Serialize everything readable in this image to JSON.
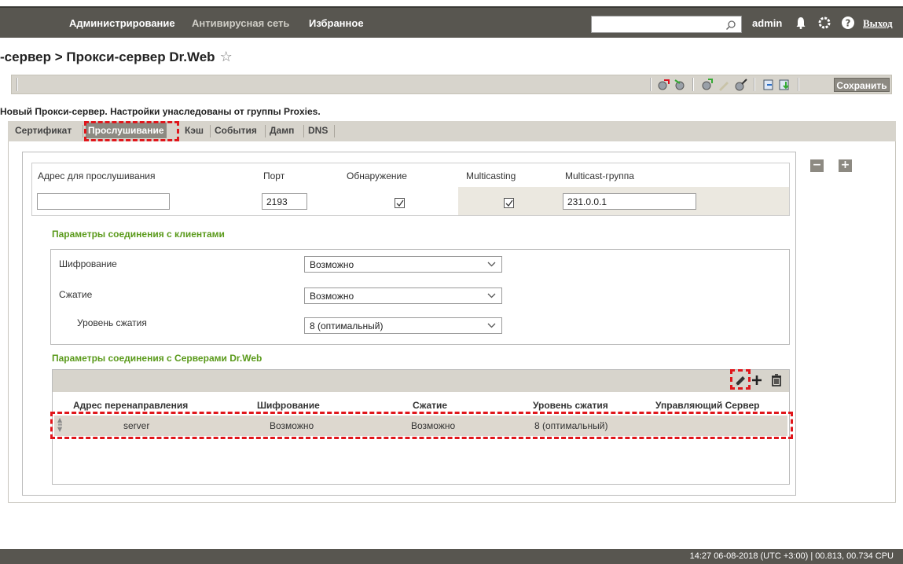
{
  "topbar": {
    "nav": [
      "Администрирование",
      "Антивирусная сеть",
      "Избранное"
    ],
    "search_value": "",
    "user": "admin",
    "exit_label": "Выход"
  },
  "breadcrumb": {
    "text": "-сервер > Прокси-сервер Dr.Web",
    "star": "☆"
  },
  "toolbar": {
    "save_label": "Сохранить"
  },
  "notice": "Новый Прокси-сервер. Настройки унаследованы от группы Proxies.",
  "tabs": [
    {
      "label": "Сертификат",
      "active": false
    },
    {
      "label": "Прослушивание",
      "active": true
    },
    {
      "label": "Кэш",
      "active": false
    },
    {
      "label": "События",
      "active": false
    },
    {
      "label": "Дамп",
      "active": false
    },
    {
      "label": "DNS",
      "active": false
    }
  ],
  "panel_buttons": {
    "minus": "−",
    "plus": "+"
  },
  "listen": {
    "headers": {
      "address": "Адрес для прослушивания",
      "port": "Порт",
      "discovery": "Обнаружение",
      "multicasting": "Multicasting",
      "group": "Multicast-группа"
    },
    "address_value": "",
    "port_value": "2193",
    "discovery_checked": true,
    "multicasting_checked": true,
    "group_value": "231.0.0.1"
  },
  "clients": {
    "title": "Параметры соединения с клиентами",
    "encryption_label": "Шифрование",
    "encryption_value": "Возможно",
    "compression_label": "Сжатие",
    "compression_value": "Возможно",
    "level_label": "Уровень сжатия",
    "level_value": "8 (оптимальный)"
  },
  "servers": {
    "title": "Параметры соединения с Серверами Dr.Web",
    "columns": [
      "Адрес перенаправления",
      "Шифрование",
      "Сжатие",
      "Уровень сжатия",
      "Управляющий Сервер"
    ],
    "rows": [
      {
        "address": "server",
        "encryption": "Возможно",
        "compression": "Возможно",
        "level": "8 (оптимальный)",
        "managing": ""
      }
    ]
  },
  "status": "14:27 06-08-2018 (UTC +3:00) | 00.813, 00.734 CPU",
  "colors": {
    "accent_green": "#5a9a1b",
    "highlight_red": "#e0161b",
    "bar": "#585650"
  }
}
